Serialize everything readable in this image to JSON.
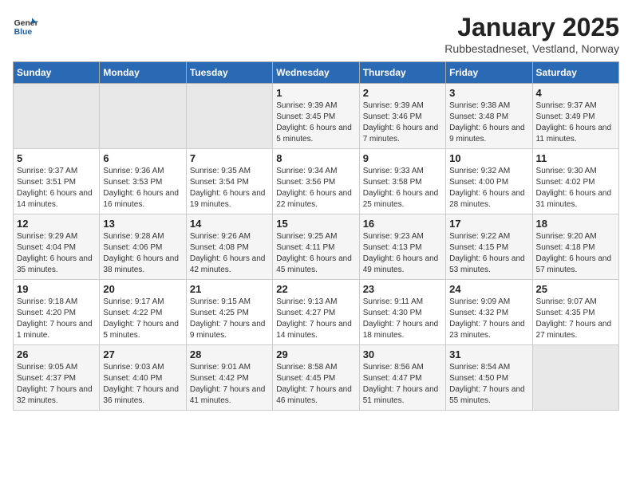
{
  "logo": {
    "text_general": "General",
    "text_blue": "Blue"
  },
  "header": {
    "month": "January 2025",
    "location": "Rubbestadneset, Vestland, Norway"
  },
  "weekdays": [
    "Sunday",
    "Monday",
    "Tuesday",
    "Wednesday",
    "Thursday",
    "Friday",
    "Saturday"
  ],
  "weeks": [
    [
      {
        "day": "",
        "sunrise": "",
        "sunset": "",
        "daylight": ""
      },
      {
        "day": "",
        "sunrise": "",
        "sunset": "",
        "daylight": ""
      },
      {
        "day": "",
        "sunrise": "",
        "sunset": "",
        "daylight": ""
      },
      {
        "day": "1",
        "sunrise": "Sunrise: 9:39 AM",
        "sunset": "Sunset: 3:45 PM",
        "daylight": "Daylight: 6 hours and 5 minutes."
      },
      {
        "day": "2",
        "sunrise": "Sunrise: 9:39 AM",
        "sunset": "Sunset: 3:46 PM",
        "daylight": "Daylight: 6 hours and 7 minutes."
      },
      {
        "day": "3",
        "sunrise": "Sunrise: 9:38 AM",
        "sunset": "Sunset: 3:48 PM",
        "daylight": "Daylight: 6 hours and 9 minutes."
      },
      {
        "day": "4",
        "sunrise": "Sunrise: 9:37 AM",
        "sunset": "Sunset: 3:49 PM",
        "daylight": "Daylight: 6 hours and 11 minutes."
      }
    ],
    [
      {
        "day": "5",
        "sunrise": "Sunrise: 9:37 AM",
        "sunset": "Sunset: 3:51 PM",
        "daylight": "Daylight: 6 hours and 14 minutes."
      },
      {
        "day": "6",
        "sunrise": "Sunrise: 9:36 AM",
        "sunset": "Sunset: 3:53 PM",
        "daylight": "Daylight: 6 hours and 16 minutes."
      },
      {
        "day": "7",
        "sunrise": "Sunrise: 9:35 AM",
        "sunset": "Sunset: 3:54 PM",
        "daylight": "Daylight: 6 hours and 19 minutes."
      },
      {
        "day": "8",
        "sunrise": "Sunrise: 9:34 AM",
        "sunset": "Sunset: 3:56 PM",
        "daylight": "Daylight: 6 hours and 22 minutes."
      },
      {
        "day": "9",
        "sunrise": "Sunrise: 9:33 AM",
        "sunset": "Sunset: 3:58 PM",
        "daylight": "Daylight: 6 hours and 25 minutes."
      },
      {
        "day": "10",
        "sunrise": "Sunrise: 9:32 AM",
        "sunset": "Sunset: 4:00 PM",
        "daylight": "Daylight: 6 hours and 28 minutes."
      },
      {
        "day": "11",
        "sunrise": "Sunrise: 9:30 AM",
        "sunset": "Sunset: 4:02 PM",
        "daylight": "Daylight: 6 hours and 31 minutes."
      }
    ],
    [
      {
        "day": "12",
        "sunrise": "Sunrise: 9:29 AM",
        "sunset": "Sunset: 4:04 PM",
        "daylight": "Daylight: 6 hours and 35 minutes."
      },
      {
        "day": "13",
        "sunrise": "Sunrise: 9:28 AM",
        "sunset": "Sunset: 4:06 PM",
        "daylight": "Daylight: 6 hours and 38 minutes."
      },
      {
        "day": "14",
        "sunrise": "Sunrise: 9:26 AM",
        "sunset": "Sunset: 4:08 PM",
        "daylight": "Daylight: 6 hours and 42 minutes."
      },
      {
        "day": "15",
        "sunrise": "Sunrise: 9:25 AM",
        "sunset": "Sunset: 4:11 PM",
        "daylight": "Daylight: 6 hours and 45 minutes."
      },
      {
        "day": "16",
        "sunrise": "Sunrise: 9:23 AM",
        "sunset": "Sunset: 4:13 PM",
        "daylight": "Daylight: 6 hours and 49 minutes."
      },
      {
        "day": "17",
        "sunrise": "Sunrise: 9:22 AM",
        "sunset": "Sunset: 4:15 PM",
        "daylight": "Daylight: 6 hours and 53 minutes."
      },
      {
        "day": "18",
        "sunrise": "Sunrise: 9:20 AM",
        "sunset": "Sunset: 4:18 PM",
        "daylight": "Daylight: 6 hours and 57 minutes."
      }
    ],
    [
      {
        "day": "19",
        "sunrise": "Sunrise: 9:18 AM",
        "sunset": "Sunset: 4:20 PM",
        "daylight": "Daylight: 7 hours and 1 minute."
      },
      {
        "day": "20",
        "sunrise": "Sunrise: 9:17 AM",
        "sunset": "Sunset: 4:22 PM",
        "daylight": "Daylight: 7 hours and 5 minutes."
      },
      {
        "day": "21",
        "sunrise": "Sunrise: 9:15 AM",
        "sunset": "Sunset: 4:25 PM",
        "daylight": "Daylight: 7 hours and 9 minutes."
      },
      {
        "day": "22",
        "sunrise": "Sunrise: 9:13 AM",
        "sunset": "Sunset: 4:27 PM",
        "daylight": "Daylight: 7 hours and 14 minutes."
      },
      {
        "day": "23",
        "sunrise": "Sunrise: 9:11 AM",
        "sunset": "Sunset: 4:30 PM",
        "daylight": "Daylight: 7 hours and 18 minutes."
      },
      {
        "day": "24",
        "sunrise": "Sunrise: 9:09 AM",
        "sunset": "Sunset: 4:32 PM",
        "daylight": "Daylight: 7 hours and 23 minutes."
      },
      {
        "day": "25",
        "sunrise": "Sunrise: 9:07 AM",
        "sunset": "Sunset: 4:35 PM",
        "daylight": "Daylight: 7 hours and 27 minutes."
      }
    ],
    [
      {
        "day": "26",
        "sunrise": "Sunrise: 9:05 AM",
        "sunset": "Sunset: 4:37 PM",
        "daylight": "Daylight: 7 hours and 32 minutes."
      },
      {
        "day": "27",
        "sunrise": "Sunrise: 9:03 AM",
        "sunset": "Sunset: 4:40 PM",
        "daylight": "Daylight: 7 hours and 36 minutes."
      },
      {
        "day": "28",
        "sunrise": "Sunrise: 9:01 AM",
        "sunset": "Sunset: 4:42 PM",
        "daylight": "Daylight: 7 hours and 41 minutes."
      },
      {
        "day": "29",
        "sunrise": "Sunrise: 8:58 AM",
        "sunset": "Sunset: 4:45 PM",
        "daylight": "Daylight: 7 hours and 46 minutes."
      },
      {
        "day": "30",
        "sunrise": "Sunrise: 8:56 AM",
        "sunset": "Sunset: 4:47 PM",
        "daylight": "Daylight: 7 hours and 51 minutes."
      },
      {
        "day": "31",
        "sunrise": "Sunrise: 8:54 AM",
        "sunset": "Sunset: 4:50 PM",
        "daylight": "Daylight: 7 hours and 55 minutes."
      },
      {
        "day": "",
        "sunrise": "",
        "sunset": "",
        "daylight": ""
      }
    ]
  ]
}
